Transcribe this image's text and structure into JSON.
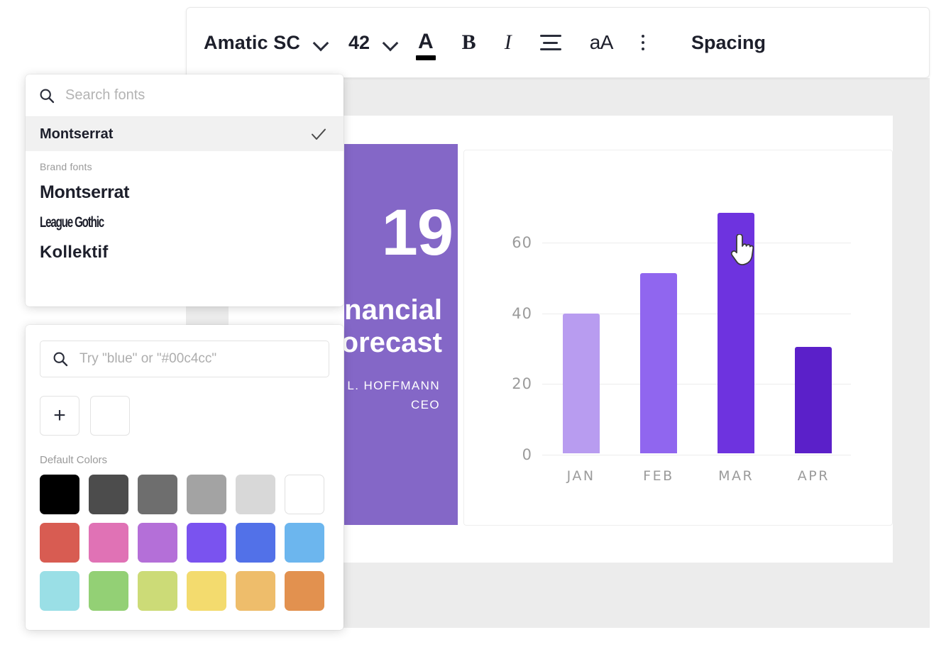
{
  "toolbar": {
    "font_name": "Amatic SC",
    "font_size": "42",
    "caret_icon": "chevron-down-icon",
    "text_color_icon": "A",
    "bold_icon": "B",
    "italic_icon": "I",
    "align_icon": "align-center-icon",
    "case_icon": "aA",
    "list_icon": "bullet-list-icon",
    "spacing_label": "Spacing"
  },
  "font_panel": {
    "search_placeholder": "Search fonts",
    "search_value": "",
    "selected_font": "Montserrat",
    "check_icon": "check-icon",
    "group_label": "Brand fonts",
    "brand_fonts": [
      {
        "name": "Montserrat"
      },
      {
        "name": "League Gothic"
      },
      {
        "name": "Kollektif"
      }
    ]
  },
  "color_panel": {
    "search_placeholder": "Try \"blue\" or \"#00c4cc\"",
    "search_value": "",
    "add_label": "+",
    "current_color": "#ffffff",
    "default_label": "Default Colors",
    "default_colors": [
      [
        "#000000",
        "#4c4c4c",
        "#6e6e6e",
        "#a3a3a3",
        "#d8d8d8",
        "#ffffff"
      ],
      [
        "#d85c52",
        "#e072b5",
        "#b46fd8",
        "#7a53ef",
        "#5271e8",
        "#6cb6ee"
      ],
      [
        "#9adfe6",
        "#93d075",
        "#ccdb77",
        "#f3db6e",
        "#eebd6b",
        "#e2914f"
      ]
    ]
  },
  "slide": {
    "year": "19",
    "title_line1": "Financial",
    "title_line2": "Forecast",
    "author_name": "L. HOFFMANN",
    "author_role": "CEO"
  },
  "chart_data": {
    "type": "bar",
    "title": "",
    "xlabel": "",
    "ylabel": "",
    "categories": [
      "JAN",
      "FEB",
      "MAR",
      "APR"
    ],
    "values": [
      39.5,
      51,
      68,
      30
    ],
    "colors": [
      "#b89cf0",
      "#9066ef",
      "#6e33df",
      "#5b20c9"
    ],
    "ylim": [
      0,
      72
    ],
    "yticks": [
      0,
      20,
      40,
      60
    ],
    "grid": true,
    "legend": "none"
  },
  "cursor": {
    "icon": "pointing-hand-cursor"
  }
}
